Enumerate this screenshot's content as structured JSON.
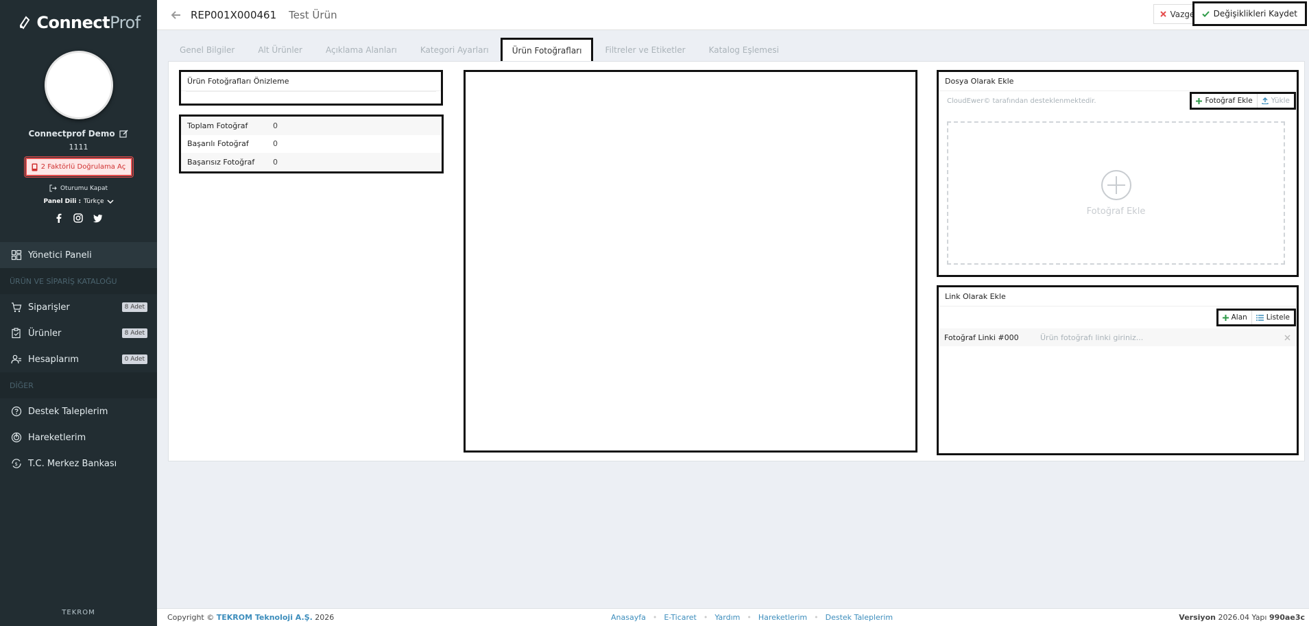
{
  "brand": {
    "part1": "Connect",
    "part2": "Prof"
  },
  "user": {
    "name": "Connectprof Demo",
    "id": "1111",
    "twofa_label": "2 Faktörlü Doğrulama Aç",
    "logout_label": "Oturumu Kapat",
    "lang_label": "Panel Dili :",
    "lang_value": "Türkçe"
  },
  "nav": {
    "dashboard": "Yönetici Paneli",
    "section_catalog": "ÜRÜN VE SİPARİŞ KATALOĞU",
    "orders": "Siparişler",
    "orders_badge": "8 Adet",
    "products": "Ürünler",
    "products_badge": "8 Adet",
    "accounts": "Hesaplarım",
    "accounts_badge": "0 Adet",
    "section_other": "DİĞER",
    "support": "Destek Taleplerim",
    "movements": "Hareketlerim",
    "bank": "T.C. Merkez Bankası"
  },
  "footer_brand": "TEKROM",
  "header": {
    "code": "REP001X000461",
    "title": "Test Ürün",
    "cancel": "Vazgeç",
    "save": "Değişiklikleri Kaydet"
  },
  "tabs": [
    "Genel Bilgiler",
    "Alt Ürünler",
    "Açıklama Alanları",
    "Kategori Ayarları",
    "Ürün Fotoğrafları",
    "Filtreler ve Etiketler",
    "Katalog Eşlemesi"
  ],
  "preview": {
    "title": "Ürün Fotoğrafları Önizleme"
  },
  "stats": [
    {
      "label": "Toplam Fotoğraf",
      "value": "0"
    },
    {
      "label": "Başarılı Fotoğraf",
      "value": "0"
    },
    {
      "label": "Başarısız Fotoğraf",
      "value": "0"
    }
  ],
  "file": {
    "title": "Dosya Olarak Ekle",
    "powered": "CloudEwer© tarafından desteklenmektedir.",
    "add_photo": "Fotoğraf Ekle",
    "upload": "Yükle",
    "drop_label": "Fotoğraf Ekle"
  },
  "link": {
    "title": "Link Olarak Ekle",
    "add_field": "Alan",
    "list": "Listele",
    "row_label": "Fotoğraf Linki #000",
    "row_placeholder": "Ürün fotoğrafı linki giriniz..."
  },
  "footer": {
    "copy_prefix": "Copyright ©",
    "company": "TEKROM Teknoloji A.Ş.",
    "year": "2026",
    "links": [
      "Anasayfa",
      "E-Ticaret",
      "Yardım",
      "Hareketlerim",
      "Destek Taleplerim"
    ],
    "version_label": "Versiyon",
    "version": "2026.04",
    "build_label": "Yapı",
    "build": "990ae3c"
  },
  "colors": {
    "sidebar": "#222d32",
    "accent": "#3c8dbc",
    "danger": "#e54d4d",
    "success": "#2e9a48"
  }
}
